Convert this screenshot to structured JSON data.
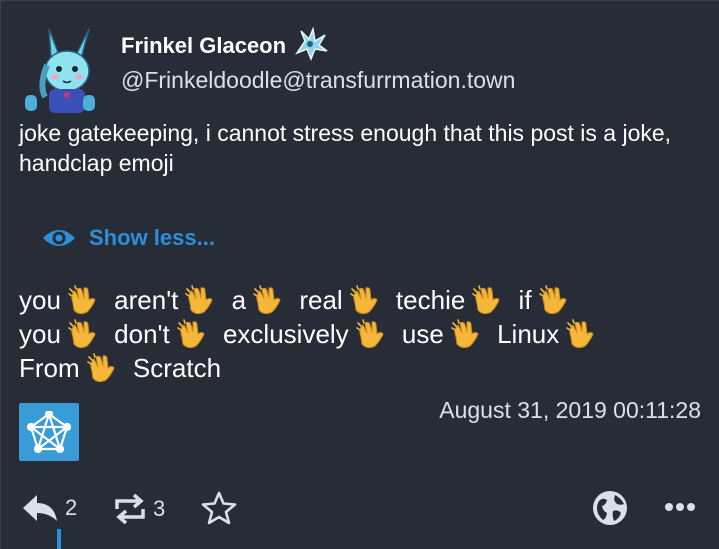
{
  "post": {
    "display_name": "Frinkel Glaceon",
    "handle": "@Frinkeldoodle@transfurrmation.town",
    "content_warning": "joke gatekeeping, i cannot stress enough that this post is a joke, handclap emoji",
    "show_less_label": "Show less...",
    "body_words": [
      "you",
      "aren't",
      "a",
      "real",
      "techie",
      "if",
      "you",
      "don't",
      "exclusively",
      "use",
      "Linux",
      "From",
      "Scratch"
    ],
    "timestamp": "August 31, 2019 00:11:28"
  },
  "actions": {
    "reply_count": "2",
    "boost_count": "3"
  },
  "icons": {
    "avatar": "glaceon-avatar",
    "name_emoji": "ice-creature-emoji",
    "show_less": "eye-icon",
    "clap": "clapping-hands-emoji",
    "app": "fediverse-icon",
    "reply": "reply-icon",
    "boost": "boost-icon",
    "favourite": "star-icon",
    "visibility": "globe-icon",
    "more": "more-icon"
  },
  "colors": {
    "background": "#282c37",
    "link": "#2b90d9",
    "secondary_text": "#d9e1e8",
    "app_badge": "#3a9bd9"
  }
}
